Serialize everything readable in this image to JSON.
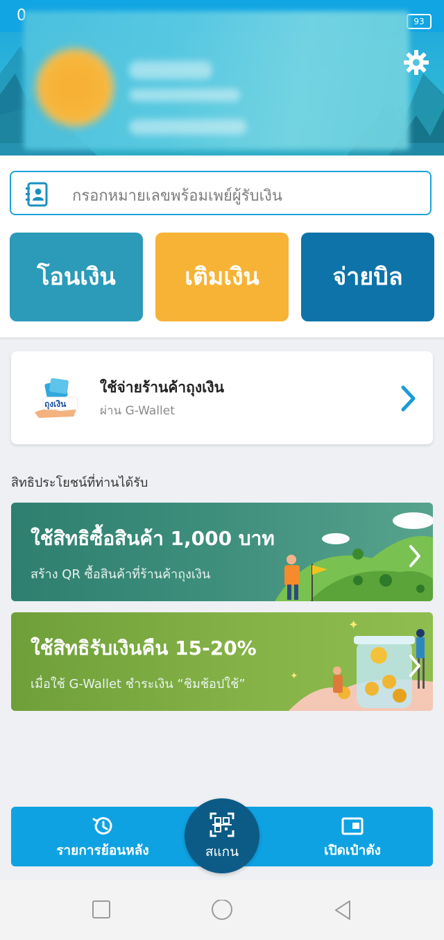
{
  "status_bar": {
    "time": "0",
    "battery": "93"
  },
  "search": {
    "placeholder": "กรอกหมายเลขพร้อมเพย์ผู้รับเงิน"
  },
  "actions": {
    "transfer": "โอนเงิน",
    "topup": "เติมเงิน",
    "pay_bill": "จ่ายบิล"
  },
  "thung_ngoen": {
    "title": "ใช้จ่ายร้านค้าถุงเงิน",
    "subtitle": "ผ่าน G-Wallet",
    "logo_text": "ถุงเงิน"
  },
  "benefits": {
    "section_title": "สิทธิประโยชน์ที่ท่านได้รับ",
    "banners": [
      {
        "title": "ใช้สิทธิซื้อสินค้า 1,000 บาท",
        "subtitle": "สร้าง QR ซื้อสินค้าที่ร้านค้าถุงเงิน"
      },
      {
        "title": "ใช้สิทธิรับเงินคืน 15-20%",
        "subtitle": "เมื่อใช้ G-Wallet ชำระเงิน “ชิมช้อปใช้”"
      }
    ]
  },
  "bottom_nav": {
    "history": "รายการย้อนหลัง",
    "scan": "สแกน",
    "wallet": "เปิดเป๋าตัง"
  },
  "colors": {
    "primary": "#0fa2e2",
    "transfer": "#2c9ab9",
    "topup": "#f7b336",
    "bill": "#0e73a8",
    "scan": "#0c5b86"
  }
}
